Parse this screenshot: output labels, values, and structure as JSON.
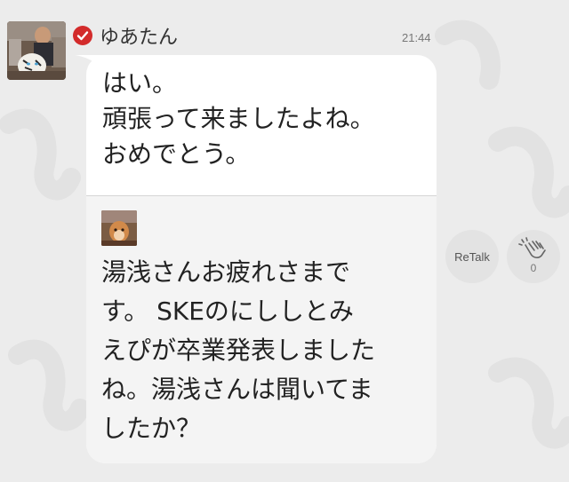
{
  "post": {
    "username": "ゆあたん",
    "time": "21:44",
    "message": "はい。\n頑張って来ましたよね。\nおめでとう。",
    "quote_text": "湯浅さんお疲れさまで\nす。 SKEのにししとみ\nえぴが卒業発表しました\nね。湯浅さんは聞いてま\nしたか？"
  },
  "actions": {
    "retalk_label": "ReTalk",
    "clap_count": "0"
  },
  "colors": {
    "background": "#ececec",
    "bubble": "#ffffff",
    "quote_background": "#f4f4f4",
    "verified_badge": "#d32b2b",
    "watermark": "#e2e2e2"
  },
  "icons": {
    "verified": "verified-check-icon",
    "clap": "clapping-hands-icon",
    "watermark": "talk-logo-watermark"
  }
}
